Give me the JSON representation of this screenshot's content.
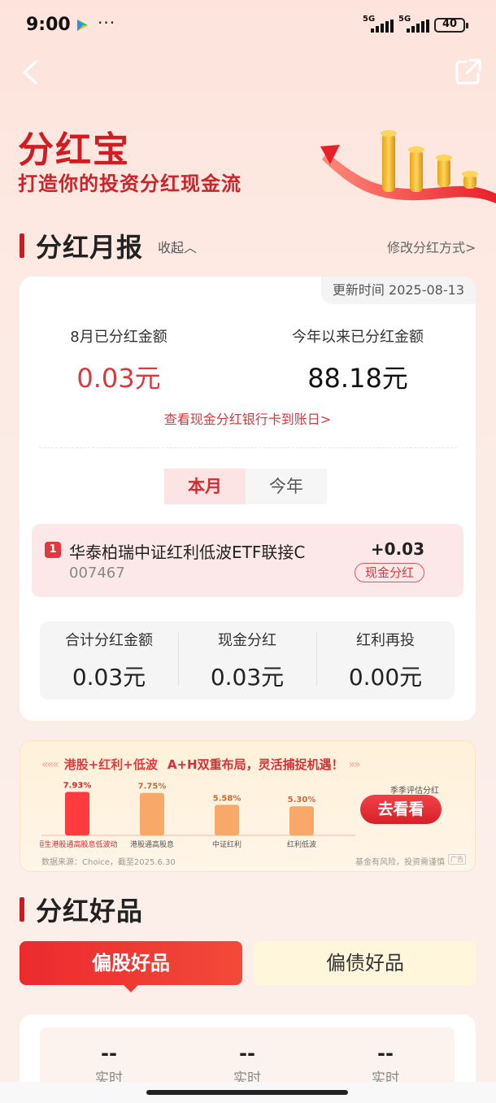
{
  "status_bar": {
    "time": "9:00",
    "more": "···",
    "network1": "5G",
    "network2": "5G",
    "battery": "40"
  },
  "hero": {
    "title": "分红宝",
    "subtitle": "打造你的投资分红现金流"
  },
  "monthly": {
    "title": "分红月报",
    "collapse": "收起︿",
    "modify": "修改分红方式>",
    "update_time": "更新时间 2025-08-13",
    "month_label": "8月已分红金额",
    "month_value": "0.03元",
    "year_label": "今年以来已分红金额",
    "year_value": "88.18元",
    "bank_link": "查看现金分红银行卡到账日>",
    "tabs": [
      "本月",
      "今年"
    ],
    "fund": {
      "rank": "1",
      "name": "华泰柏瑞中证红利低波ETF联接C",
      "code": "007467",
      "amount": "+0.03",
      "tag": "现金分红"
    },
    "summary": [
      {
        "label": "合计分红金额",
        "value": "0.03元"
      },
      {
        "label": "现金分红",
        "value": "0.03元"
      },
      {
        "label": "红利再投",
        "value": "0.00元"
      }
    ]
  },
  "banner": {
    "tag": "港股+红利+低波",
    "slogan": "A+H双重布局，灵活捕捉机遇！",
    "chart_data": {
      "type": "bar",
      "categories": [
        "恒生港股通高股息低波动",
        "港股通高股息",
        "中证红利",
        "红利低波"
      ],
      "values": [
        7.93,
        7.75,
        5.58,
        5.3
      ],
      "value_labels": [
        "7.93%",
        "7.75%",
        "5.58%",
        "5.30%"
      ]
    },
    "note_top": "季季评估分红",
    "button": "去看看",
    "source": "数据来源：Choice，截至2025.6.30",
    "risk": "基金有风险，投资需谨慎",
    "ad": "广告"
  },
  "products": {
    "title": "分红好品",
    "tabs": [
      "偏股好品",
      "偏债好品"
    ],
    "metrics": [
      {
        "value": "--",
        "label": "实时"
      },
      {
        "value": "--",
        "label": "实时"
      },
      {
        "value": "--",
        "label": "实时"
      }
    ]
  },
  "colors": {
    "accent": "#d52c31",
    "banner_bar_top": "#ff3b40",
    "banner_bar_other": "#f8a868"
  }
}
